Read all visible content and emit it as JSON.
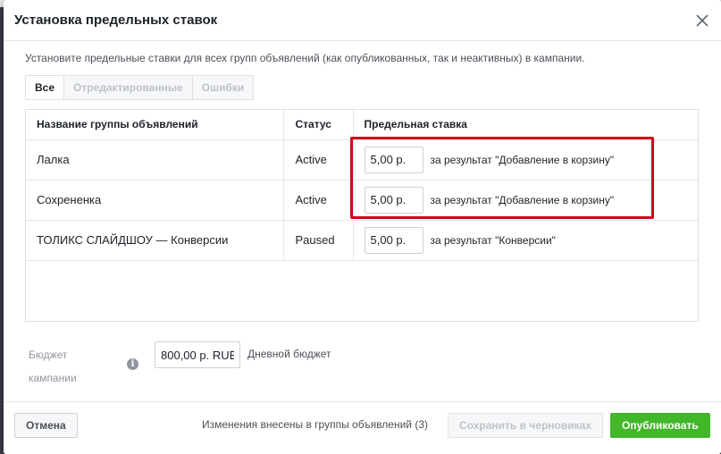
{
  "dialog": {
    "title": "Установка предельных ставок",
    "subtitle": "Установите предельные ставки для всех групп объявлений (как опубликованных, так и неактивных) в кампании."
  },
  "tabs": [
    {
      "label": "Все",
      "active": true
    },
    {
      "label": "Отредактированные",
      "active": false
    },
    {
      "label": "Ошибки",
      "active": false
    }
  ],
  "table": {
    "headers": {
      "name": "Название группы объявлений",
      "status": "Статус",
      "bid": "Предельная ставка"
    },
    "rows": [
      {
        "name": "Лалка",
        "status": "Active",
        "bid": "5,00 р.",
        "desc": "за результат \"Добавление в корзину\""
      },
      {
        "name": "Сохрененка",
        "status": "Active",
        "bid": "5,00 р.",
        "desc": "за результат \"Добавление в корзину\""
      },
      {
        "name": "ТОЛИКС СЛАЙДШОУ — Конверсии",
        "status": "Paused",
        "bid": "5,00 р.",
        "desc": "за результат \"Конверсии\""
      }
    ]
  },
  "budget": {
    "label": "Бюджет кампании",
    "info_icon": "info-icon",
    "value": "800,00 р. RUB",
    "type": "Дневной бюджет"
  },
  "footer": {
    "cancel_label": "Отмена",
    "changes_text": "Изменения внесены в группы объявлений (3)",
    "draft_label": "Сохранить в черновиках",
    "publish_label": "Опубликовать"
  },
  "colors": {
    "highlight": "#d0021b",
    "publish": "#42b72a"
  }
}
